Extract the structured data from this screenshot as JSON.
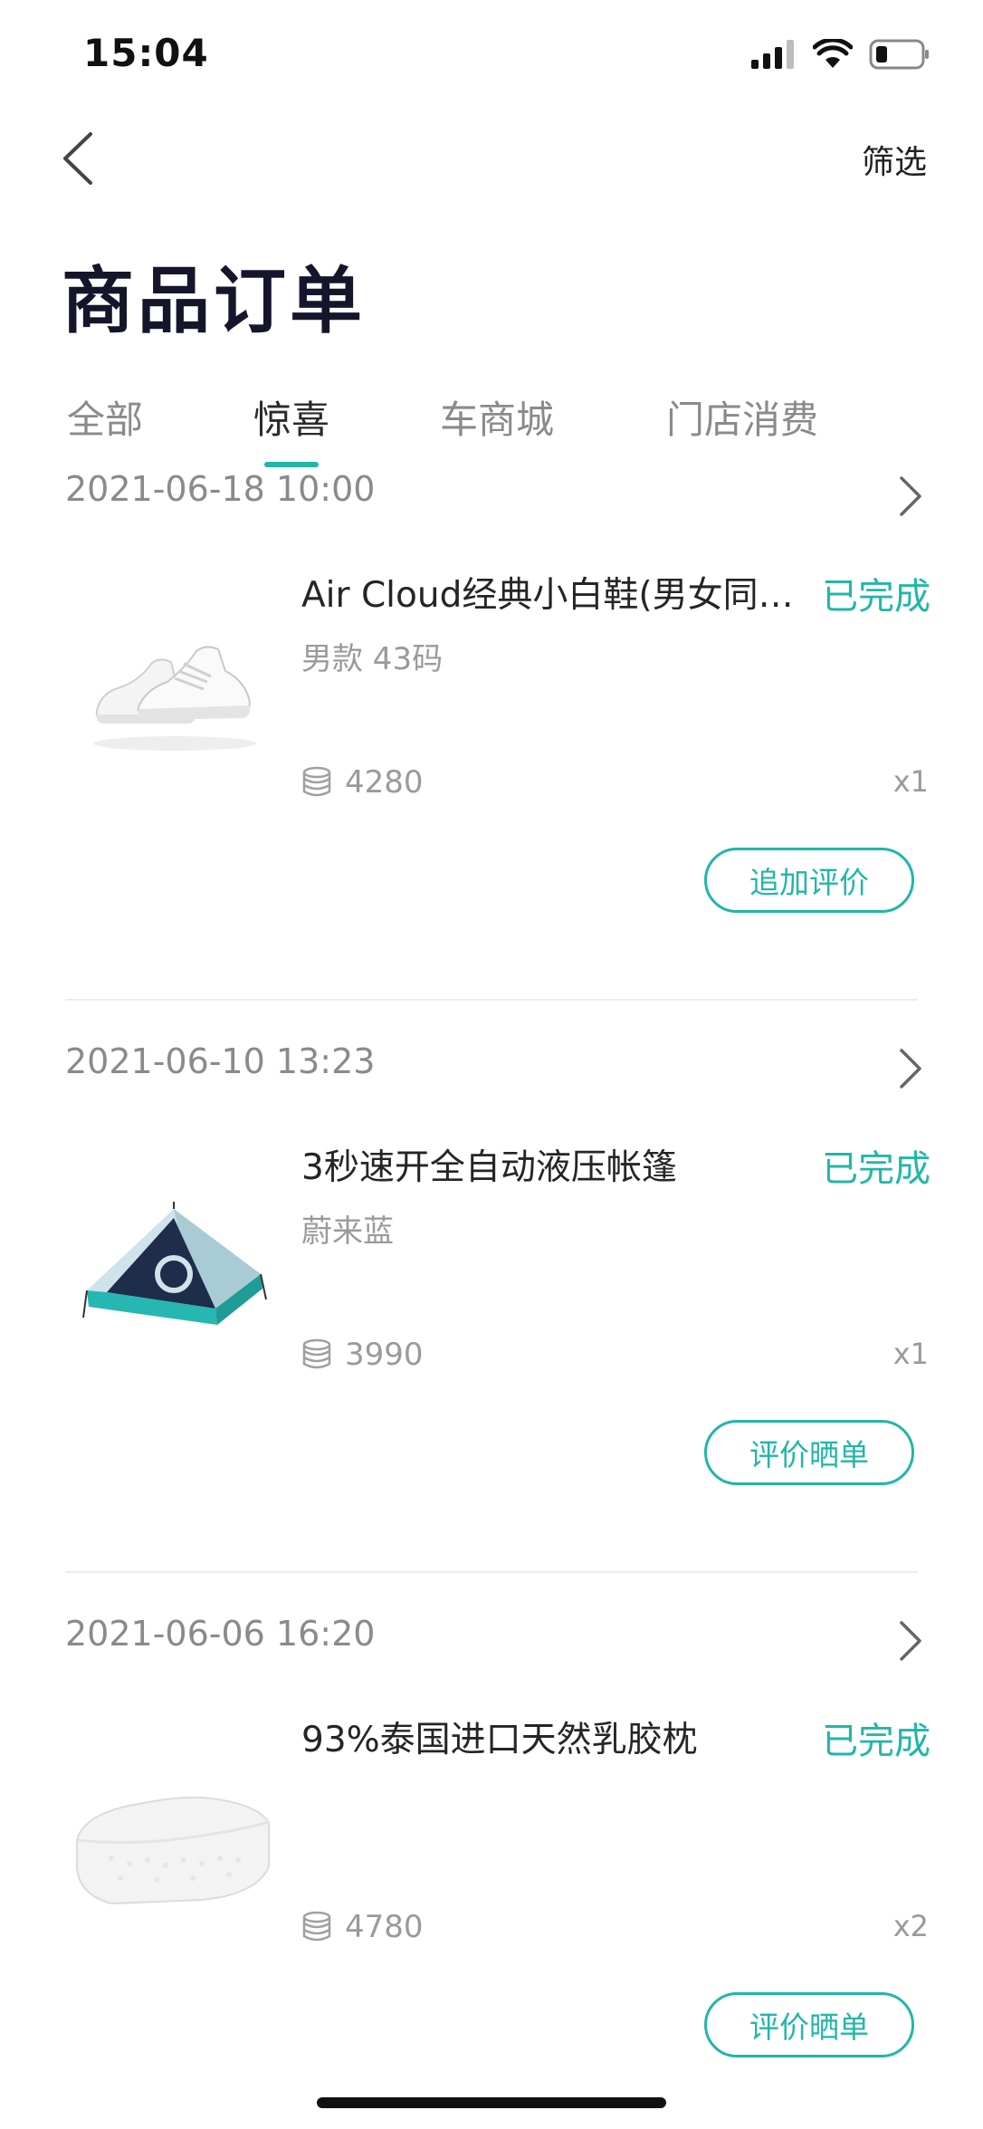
{
  "status_bar": {
    "time": "15:04"
  },
  "nav": {
    "filter_label": "筛选"
  },
  "page": {
    "title": "商品订单"
  },
  "tabs": [
    {
      "label": "全部"
    },
    {
      "label": "惊喜",
      "active": true
    },
    {
      "label": "车商城"
    },
    {
      "label": "门店消费"
    },
    {
      "label": ""
    }
  ],
  "theme": {
    "accent": "#22b6a8"
  },
  "orders": [
    {
      "date": "2021-06-18 10:00",
      "product_name": "Air Cloud经典小白鞋(男女同…",
      "status": "已完成",
      "variant": "男款 43码",
      "price": "4280",
      "quantity": "x1",
      "action": "追加评价",
      "image": "sneaker-image"
    },
    {
      "date": "2021-06-10 13:23",
      "product_name": "3秒速开全自动液压帐篷",
      "status": "已完成",
      "variant": "蔚来蓝",
      "price": "3990",
      "quantity": "x1",
      "action": "评价晒单",
      "image": "tent-image"
    },
    {
      "date": "2021-06-06 16:20",
      "product_name": "93%泰国进口天然乳胶枕",
      "status": "已完成",
      "variant": "",
      "price": "4780",
      "quantity": "x2",
      "action": "评价晒单",
      "image": "pillow-image"
    }
  ]
}
